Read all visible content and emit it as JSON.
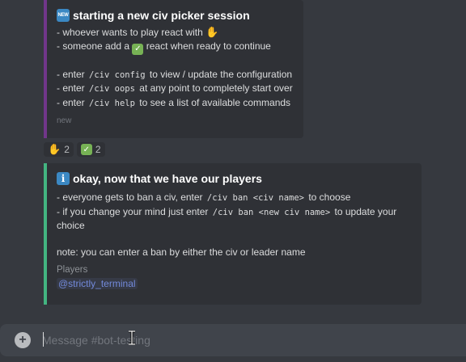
{
  "embed1": {
    "badge": "NEW",
    "title": "starting a new civ picker session",
    "line1_text": "- whoever wants to play react with",
    "line1_emoji": "✋",
    "line2_pre": "- someone add a",
    "line2_post": "react when ready to continue",
    "line3_pre": "- enter",
    "line3_code": "/civ config",
    "line3_post": "to view / update the configuration",
    "line4_pre": "- enter",
    "line4_code": "/civ oops",
    "line4_post": "at any point to completely start over",
    "line5_pre": "- enter",
    "line5_code": "/civ help",
    "line5_post": "to see a list of available commands",
    "footer": "new"
  },
  "reactions": [
    {
      "emoji": "✋",
      "count": "2"
    },
    {
      "emoji": "✅",
      "count": "2"
    }
  ],
  "embed2": {
    "badge": "i",
    "title": "okay, now that we have our players",
    "line1_pre": "- everyone gets to ban a civ, enter",
    "line1_code": "/civ ban <civ name>",
    "line1_post": "to choose",
    "line2_pre": "- if you change your mind just enter",
    "line2_code": "/civ ban <new civ name>",
    "line2_post": "to update your choice",
    "note": "note: you can enter a ban by either the civ or leader name",
    "field_name": "Players",
    "field_value": "@strictly_terminal"
  },
  "composer": {
    "placeholder": "Message #bot-testing"
  },
  "colors": {
    "embed1_accent": "#71368a",
    "embed2_accent": "#43b581",
    "mention": "#7289da"
  }
}
